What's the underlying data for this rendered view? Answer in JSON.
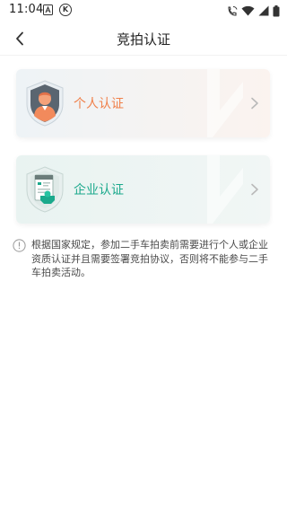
{
  "status_bar": {
    "time": "11:04",
    "icons": [
      "a-notification-icon",
      "k-circle-icon",
      "call-wifi-icon",
      "wifi-icon",
      "signal-icon",
      "battery-icon"
    ]
  },
  "nav": {
    "title": "竞拍认证",
    "back_icon": "chevron-left-icon"
  },
  "cards": [
    {
      "label": "个人认证",
      "icon": "person-avatar-icon",
      "accent": "#f0804a"
    },
    {
      "label": "企业认证",
      "icon": "enterprise-building-icon",
      "accent": "#1ba98c"
    }
  ],
  "notice": {
    "icon": "info-circle-icon",
    "text": "根据国家规定，参加二手车拍卖前需要进行个人或企业资质认证并且需要签署竞拍协议，否则将不能参与二手车拍卖活动。"
  }
}
